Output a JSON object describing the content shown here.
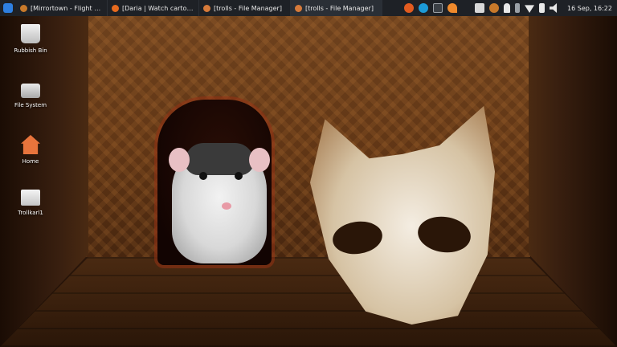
{
  "taskbar": {
    "tasks": [
      {
        "label": "[Mirrortown - Flight of the M...",
        "icon": "mirrortown-icon",
        "color": "#c8792a"
      },
      {
        "label": "[Daria | Watch cartoons onl...",
        "icon": "firefox-icon",
        "color": "#e66a1e"
      },
      {
        "label": "[trolls - File Manager]",
        "icon": "file-manager-icon",
        "color": "#d67a3a"
      },
      {
        "label": "[trolls - File Manager]",
        "icon": "file-manager-icon",
        "color": "#d67a3a"
      }
    ],
    "launchers": [
      "firefox-icon",
      "skype-icon",
      "terminal-icon",
      "files-icon"
    ],
    "tray": [
      "screenshot-icon",
      "mirrortown-tray-icon",
      "notifications-icon",
      "bluetooth-icon",
      "wifi-icon",
      "battery-icon",
      "volume-icon"
    ],
    "clock": "16 Sep, 16:22"
  },
  "desktop_icons": [
    {
      "label": "Rubbish Bin",
      "icon": "trash-icon"
    },
    {
      "label": "File System",
      "icon": "drive-icon"
    },
    {
      "label": "Home",
      "icon": "home-folder-icon"
    },
    {
      "label": "Trollkarl1",
      "icon": "usb-drive-icon"
    }
  ]
}
